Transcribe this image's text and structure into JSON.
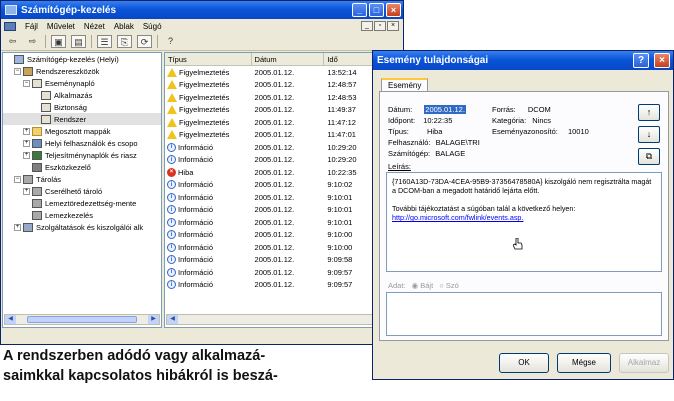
{
  "main_window": {
    "title": "Számítógép-kezelés",
    "menu": [
      "Fájl",
      "Művelet",
      "Nézet",
      "Ablak",
      "Súgó"
    ],
    "toolbar_icons": [
      "back-arrow-icon",
      "forward-arrow-icon",
      "up-folder-icon",
      "show-tree-icon",
      "properties-icon",
      "export-icon",
      "refresh-icon",
      "help-icon"
    ]
  },
  "tree": [
    {
      "label": "Számítógép-kezelés (Helyi)",
      "indent": 0,
      "expander": "",
      "icon": "pc"
    },
    {
      "label": "Rendszereszközök",
      "indent": 1,
      "expander": "−",
      "icon": "tools"
    },
    {
      "label": "Eseménynapló",
      "indent": 2,
      "expander": "−",
      "icon": "log"
    },
    {
      "label": "Alkalmazás",
      "indent": 3,
      "expander": "",
      "icon": "log"
    },
    {
      "label": "Biztonság",
      "indent": 3,
      "expander": "",
      "icon": "log"
    },
    {
      "label": "Rendszer",
      "indent": 3,
      "expander": "",
      "icon": "log",
      "selected": true
    },
    {
      "label": "Megosztott mappák",
      "indent": 2,
      "expander": "+",
      "icon": "folder"
    },
    {
      "label": "Helyi felhasználók és csopo",
      "indent": 2,
      "expander": "+",
      "icon": "users"
    },
    {
      "label": "Teljesítménynaplók és riasz",
      "indent": 2,
      "expander": "+",
      "icon": "perf"
    },
    {
      "label": "Eszközkezelő",
      "indent": 2,
      "expander": "",
      "icon": "dev"
    },
    {
      "label": "Tárolás",
      "indent": 1,
      "expander": "−",
      "icon": "disk"
    },
    {
      "label": "Cserélhető tároló",
      "indent": 2,
      "expander": "+",
      "icon": "disk"
    },
    {
      "label": "Lemeztöredezettség-mente",
      "indent": 2,
      "expander": "",
      "icon": "disk"
    },
    {
      "label": "Lemezkezelés",
      "indent": 2,
      "expander": "",
      "icon": "disk"
    },
    {
      "label": "Szolgáltatások és kiszolgálói alk",
      "indent": 1,
      "expander": "+",
      "icon": "svc"
    }
  ],
  "list": {
    "columns": [
      "Típus",
      "Dátum",
      "Idő"
    ],
    "rows": [
      {
        "type": "Figyelmeztetés",
        "icon": "warn",
        "date": "2005.01.12.",
        "time": "13:52:14"
      },
      {
        "type": "Figyelmeztetés",
        "icon": "warn",
        "date": "2005.01.12.",
        "time": "12:48:57"
      },
      {
        "type": "Figyelmeztetés",
        "icon": "warn",
        "date": "2005.01.12.",
        "time": "12:48:53"
      },
      {
        "type": "Figyelmeztetés",
        "icon": "warn",
        "date": "2005.01.12.",
        "time": "11:49:37"
      },
      {
        "type": "Figyelmeztetés",
        "icon": "warn",
        "date": "2005.01.12.",
        "time": "11:47:12"
      },
      {
        "type": "Figyelmeztetés",
        "icon": "warn",
        "date": "2005.01.12.",
        "time": "11:47:01"
      },
      {
        "type": "Információ",
        "icon": "info",
        "date": "2005.01.12.",
        "time": "10:29:20"
      },
      {
        "type": "Információ",
        "icon": "info",
        "date": "2005.01.12.",
        "time": "10:29:20"
      },
      {
        "type": "Hiba",
        "icon": "error",
        "date": "2005.01.12.",
        "time": "10:22:35"
      },
      {
        "type": "Információ",
        "icon": "info",
        "date": "2005.01.12.",
        "time": "9:10:02"
      },
      {
        "type": "Információ",
        "icon": "info",
        "date": "2005.01.12.",
        "time": "9:10:01"
      },
      {
        "type": "Információ",
        "icon": "info",
        "date": "2005.01.12.",
        "time": "9:10:01"
      },
      {
        "type": "Információ",
        "icon": "info",
        "date": "2005.01.12.",
        "time": "9:10:01"
      },
      {
        "type": "Információ",
        "icon": "info",
        "date": "2005.01.12.",
        "time": "9:10:00"
      },
      {
        "type": "Információ",
        "icon": "info",
        "date": "2005.01.12.",
        "time": "9:10:00"
      },
      {
        "type": "Információ",
        "icon": "info",
        "date": "2005.01.12.",
        "time": "9:09:58"
      },
      {
        "type": "Információ",
        "icon": "info",
        "date": "2005.01.12.",
        "time": "9:09:57"
      },
      {
        "type": "Információ",
        "icon": "info",
        "date": "2005.01.12.",
        "time": "9:09:57"
      }
    ]
  },
  "dialog": {
    "title": "Esemény tulajdonságai",
    "tab": "Esemény",
    "date_label": "Dátum:",
    "date_value": "2005.01.12.",
    "source_label": "Forrás:",
    "source_value": "DCOM",
    "time_label": "Időpont:",
    "time_value": "10:22:35",
    "category_label": "Kategória:",
    "category_value": "Nincs",
    "type_label": "Típus:",
    "type_value": "Hiba",
    "event_id_label": "Eseményazonosító:",
    "event_id_value": "10010",
    "user_label": "Felhasználó:",
    "user_value": "BALAGE\\TRI",
    "computer_label": "Számítógép:",
    "computer_value": "BALAGE",
    "description_label": "Leírás:",
    "description_text": "{7160A13D-73DA-4CEA-95B9-37356478580A} kiszolgáló nem regisztrálta magát a DCOM-ban a megadott határidő lejárta előtt.",
    "more_info_text": "További tájékoztatást a súgóban talál a következő helyen:",
    "link": "http://go.microsoft.com/fwlink/events.asp.",
    "data_label": "Adat:",
    "radio_bytes": "Bájt",
    "radio_words": "Szó",
    "ok": "OK",
    "cancel": "Mégse",
    "apply": "Alkalmaz",
    "colors": {
      "accent": "#316ac5",
      "titlebar": "#0a55d8"
    }
  },
  "caption": {
    "line1": "A rendszerben adódó vagy alkalmazá-",
    "line2": "saimkkal kapcsolatos hibákról is beszá-"
  }
}
